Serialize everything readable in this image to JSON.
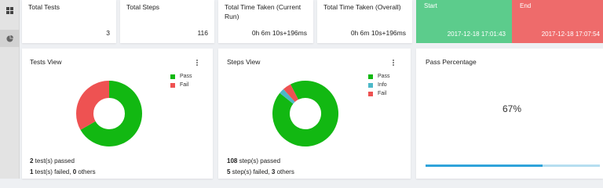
{
  "colors": {
    "pass": "#12b812",
    "fail": "#ee5252",
    "info": "#4db8c8",
    "start_card": "#5ccc8c",
    "end_card": "#ee6b6b",
    "progress_fill": "#2fa3da",
    "progress_track": "#b6def0"
  },
  "sidebar": {
    "items": [
      {
        "icon": "dashboard-grid-icon"
      },
      {
        "icon": "pie-chart-icon"
      }
    ]
  },
  "stats": {
    "total_tests": {
      "label": "Total Tests",
      "value": "3"
    },
    "total_steps": {
      "label": "Total Steps",
      "value": "116"
    },
    "time_current": {
      "label": "Total Time Taken (Current Run)",
      "value": "0h 6m 10s+196ms"
    },
    "time_overall": {
      "label": "Total Time Taken (Overall)",
      "value": "0h 6m 10s+196ms"
    }
  },
  "timing": {
    "start": {
      "label": "Start",
      "value": "2017-12-18 17:01:43"
    },
    "end": {
      "label": "End",
      "value": "2017-12-18 17:07:54"
    }
  },
  "tests_view": {
    "title": "Tests View",
    "legend": [
      "Pass",
      "Fail"
    ],
    "slices": [
      {
        "name": "Pass",
        "value": 2
      },
      {
        "name": "Fail",
        "value": 1
      }
    ],
    "passed_count": "2",
    "passed_text": " test(s) passed",
    "failed_count": "1",
    "failed_text": " test(s) failed, ",
    "others_count": "0",
    "others_text": " others"
  },
  "steps_view": {
    "title": "Steps View",
    "legend": [
      "Pass",
      "Info",
      "Fail"
    ],
    "slices": [
      {
        "name": "Pass",
        "value": 108
      },
      {
        "name": "Info",
        "value": 3
      },
      {
        "name": "Fail",
        "value": 5
      }
    ],
    "passed_count": "108",
    "passed_text": " step(s) passed",
    "failed_count": "5",
    "failed_text": " step(s) failed, ",
    "others_count": "3",
    "others_text": " others"
  },
  "pass_percentage": {
    "title": "Pass Percentage",
    "value": "67%",
    "fraction": 0.67
  }
}
